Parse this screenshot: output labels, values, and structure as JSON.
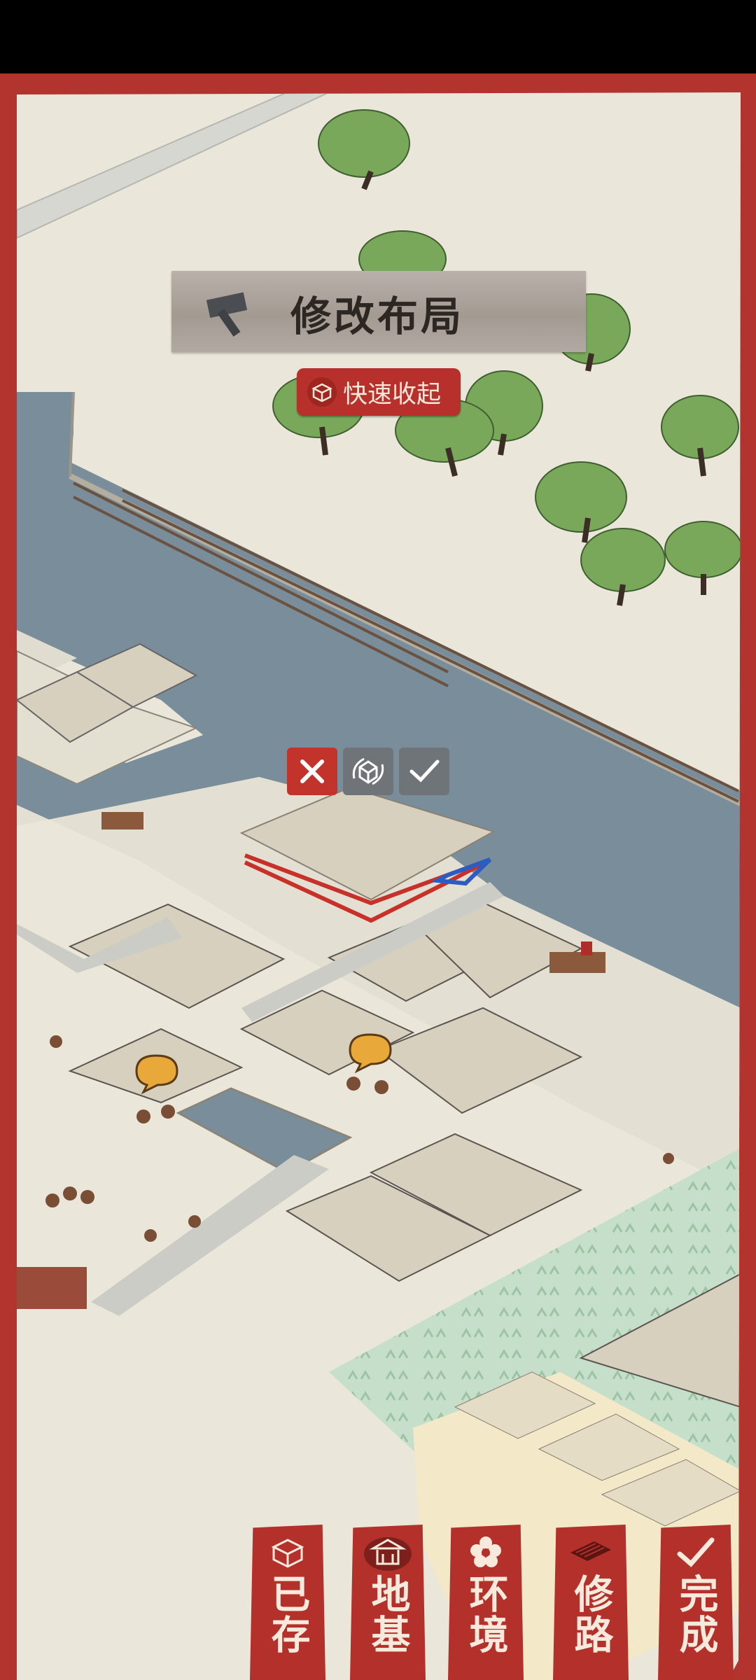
{
  "colors": {
    "frame": "#b3332e",
    "paper": "#eae7da",
    "water": "#7a8d9a",
    "plot": "#d8d0bf",
    "path": "#ccccc7",
    "farmland": "#bfd9c5"
  },
  "header": {
    "title": "修改布局",
    "icon": "hammer-icon"
  },
  "quick_collapse": {
    "label": "快速收起",
    "icon": "box-icon"
  },
  "placement_controls": [
    {
      "name": "cancel",
      "icon": "close-icon"
    },
    {
      "name": "rotate",
      "icon": "rotate-icon"
    },
    {
      "name": "confirm",
      "icon": "check-icon"
    }
  ],
  "toolbar": {
    "items": [
      {
        "id": "saved",
        "label": "已存",
        "icon": "box-icon"
      },
      {
        "id": "foundation",
        "label": "地基",
        "icon": "house-icon"
      },
      {
        "id": "environment",
        "label": "环境",
        "icon": "flower-icon"
      },
      {
        "id": "road",
        "label": "修路",
        "icon": "road-tile-icon"
      },
      {
        "id": "done",
        "label": "完成",
        "icon": "check-icon"
      }
    ]
  }
}
